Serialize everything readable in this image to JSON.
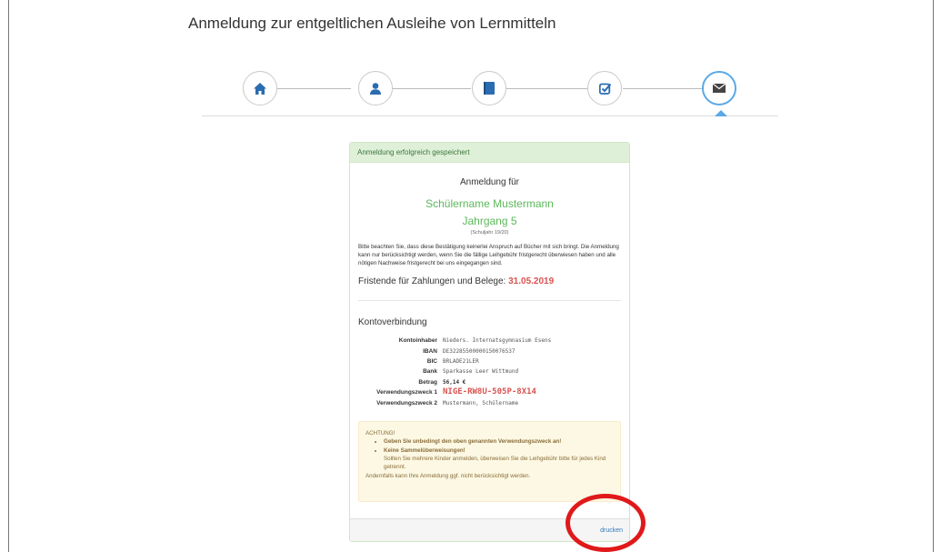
{
  "page": {
    "title": "Anmeldung zur entgeltlichen Ausleihe von Lernmitteln"
  },
  "wizard": {
    "steps": [
      {
        "icon": "home-icon",
        "active": false
      },
      {
        "icon": "user-icon",
        "active": false
      },
      {
        "icon": "book-icon",
        "active": false
      },
      {
        "icon": "checkbox-icon",
        "active": false
      },
      {
        "icon": "envelope-icon",
        "active": true
      }
    ],
    "active_color": "#5aa9e6",
    "icon_color": "#2b6cb0"
  },
  "panel": {
    "heading": "Anmeldung erfolgreich gespeichert",
    "registration_for": "Anmeldung für",
    "student_name": "Schülername Mustermann",
    "grade": "Jahrgang 5",
    "school_year": "(Schuljahr 19/20)",
    "notice": "Bitte beachten Sie, dass diese Bestätigung keinerlei Anspruch auf Bücher mit sich bringt. Die Anmeldung kann nur berücksichtigt werden, wenn Sie die fällige Leihgebühr fristgerecht überwiesen haben und alle nötigen Nachweise fristgerecht bei uns eingegangen sind.",
    "deadline_label": "Fristende für Zahlungen und Belege:",
    "deadline_date": "31.05.2019",
    "account_title": "Kontoverbindung",
    "account": {
      "holder_label": "Kontoinhaber",
      "holder": "Nieders. Internatsgymnasium Esens",
      "iban_label": "IBAN",
      "iban": "DE32285500000150076537",
      "bic_label": "BIC",
      "bic": "BRLADE21LER",
      "bank_label": "Bank",
      "bank": "Sparkasse Leer Wittmund",
      "amount_label": "Betrag",
      "amount": "56,14 €",
      "purpose1_label": "Verwendungszweck 1",
      "purpose1": "NIGE-RW8U-505P-8X14",
      "purpose2_label": "Verwendungszweck 2",
      "purpose2": "Mustermann, Schülername"
    },
    "alert": {
      "title": "ACHTUNG!",
      "item1": "Geben Sie unbedingt den oben genannten Verwendungszweck an!",
      "item2": "Keine Sammelüberweisungen!",
      "item2_sub": "Sollten Sie mehrere Kinder anmelden, überweisen Sie die Leihgebühr bitte für jedes Kind getrennt.",
      "footer": "Andernfalls kann Ihre Anmeldung ggf. nicht berücksichtigt werden."
    },
    "print_label": "drucken"
  },
  "colors": {
    "success_green": "#5cb85c",
    "danger_red": "#d9534f",
    "annotation_red": "#e0191a"
  }
}
